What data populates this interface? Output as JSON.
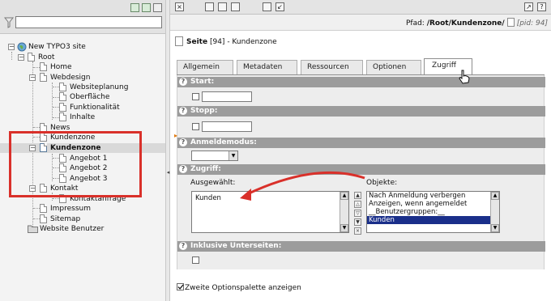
{
  "tree": {
    "root_site": "New TYPO3 site",
    "items": [
      {
        "label": "Root",
        "bold": false
      },
      {
        "label": "Home",
        "bold": false
      },
      {
        "label": "Webdesign",
        "bold": false
      },
      {
        "label": "Websiteplanung",
        "bold": false
      },
      {
        "label": "Oberfläche",
        "bold": false
      },
      {
        "label": "Funktionalität",
        "bold": false
      },
      {
        "label": "Inhalte",
        "bold": false
      },
      {
        "label": "News",
        "bold": false
      },
      {
        "label": "Kundenzone",
        "bold": false
      },
      {
        "label": "Kundenzone",
        "bold": true
      },
      {
        "label": "Angebot 1",
        "bold": false
      },
      {
        "label": "Angebot 2",
        "bold": false
      },
      {
        "label": "Angebot 3",
        "bold": false
      },
      {
        "label": "Kontakt",
        "bold": false
      },
      {
        "label": "Kontaktanfrage",
        "bold": false
      },
      {
        "label": "Impressum",
        "bold": false
      },
      {
        "label": "Sitemap",
        "bold": false
      },
      {
        "label": "Website Benutzer",
        "bold": false
      }
    ]
  },
  "path": {
    "prefix": "Pfad:",
    "value": "/Root/Kundenzone/",
    "pid": "[pid: 94]"
  },
  "page_title": {
    "type": "Seite",
    "id": "[94]",
    "name": "- Kundenzone"
  },
  "tabs": [
    {
      "label": "Allgemein",
      "active": false
    },
    {
      "label": "Metadaten",
      "active": false
    },
    {
      "label": "Ressourcen",
      "active": false
    },
    {
      "label": "Optionen",
      "active": false
    },
    {
      "label": "Zugriff",
      "active": true
    }
  ],
  "sections": {
    "start": "Start:",
    "stop": "Stopp:",
    "login_mode": "Anmeldemodus:",
    "access": "Zugriff:",
    "include_subpages": "Inklusive Unterseiten:"
  },
  "access": {
    "selected_label": "Ausgewählt:",
    "objects_label": "Objekte:",
    "selected_items": [
      "Kunden"
    ],
    "objects_items": [
      "Nach Anmeldung verbergen",
      "Anzeigen, wenn angemeldet",
      "__Benutzergruppen:__",
      "Kunden"
    ],
    "highlighted_object": "Kunden"
  },
  "bottom": {
    "second_palette_label": "Zweite Optionspalette anzeigen",
    "checked": true
  },
  "colors": {
    "callout": "#d9302a",
    "section_header": "#9c9c9c",
    "selection": "#1a2f8a"
  }
}
